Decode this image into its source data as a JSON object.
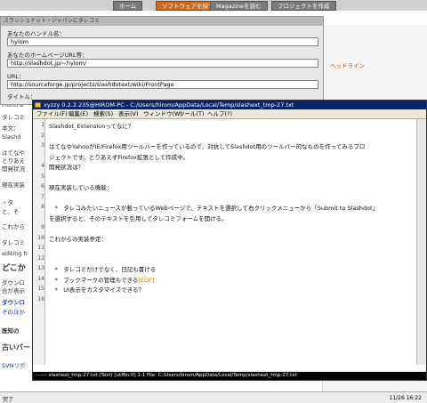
{
  "browser": {
    "tabs": [
      "ホーム",
      "ソフトウェアを探す",
      "Magazineを読む",
      "プロジェクトを作成"
    ],
    "statusbar_left": "完了",
    "statusbar_right": "11/26 16:22"
  },
  "slashdot_panel": {
    "title": "スラッシュドット・ジャパンにタレコミ",
    "handle_label": "あなたのハンドル名：",
    "handle_value": "hylom",
    "homepage_label": "あなたのホームページURL等：",
    "homepage_value": "http://slashdot.jp/~hylom/",
    "url_label": "URL：",
    "url_value": "http://sourceforge.jp/projects/slashdotext/wiki/FrontPage",
    "title_label": "タイトル："
  },
  "background_fragments": [
    "FrontPa",
    "タレコミ",
    "本文：",
    "Slashd",
    "はてなや",
    "とりあえ",
    "開発状況",
    "現在実装",
    "・タ",
    "と、そ",
    "これから",
    "タレコミ",
    "editing fr",
    "どこか",
    "ダウンロ",
    "合が表示",
    "ダウンロ",
    "そのほか",
    "既知の",
    "古いバー",
    "SVNリポ"
  ],
  "right_pane": {
    "heading_fragment": "ヘッドライン"
  },
  "editor": {
    "title": "xyzzy 0.2.2.235@HIROM-PC - C:/Users/hirom/AppData/Local/Temp/slashext_tmp-27.txt",
    "menu": [
      "ファイル(F)",
      "編集(E)",
      "検索(S)",
      "表示(V)",
      "ウィンドウ(W)",
      "ツール(T)",
      "ヘルプ(?)"
    ],
    "lines": [
      {
        "n": "1",
        "text": "Slashdot_Extensionってなに？"
      },
      {
        "n": "2",
        "text": ""
      },
      {
        "n": "3",
        "text": "はてなやYahooがIE/Firefox用ツールバーを作っているので、対抗してSlashdot用のツールバー的なものを作ってみるプロ"
      },
      {
        "n": "",
        "text": "ジェクトです。とりあえずFirefox拡張として作成中。"
      },
      {
        "n": "4",
        "text": "開発状況は？"
      },
      {
        "n": "5",
        "text": ""
      },
      {
        "n": "6",
        "text": "現在実装している機能："
      },
      {
        "n": "7",
        "text": ""
      },
      {
        "n": "8",
        "text": "　*　タレコみたいニュースが載っているWebページで、テキストを選択して右クリックメニューから「Submit to Slashdot」"
      },
      {
        "n": "",
        "text": "を選択すると、そのテキストを引用してタレコミフォームを開ける。"
      },
      {
        "n": "9",
        "text": ""
      },
      {
        "n": "10",
        "text": "これからの実装予定："
      },
      {
        "n": "11",
        "text": ""
      },
      {
        "n": "12",
        "text": ""
      },
      {
        "n": "13",
        "text": "　*　タレコミだけでなく、日記も書ける"
      },
      {
        "n": "14",
        "text": "　*　ブックマークの管理もできる"
      },
      {
        "n": "15",
        "text": "　*　UI表示をカスタマイズできる？"
      },
      {
        "n": "16",
        "text": ""
      }
    ],
    "eof_marker": "[EOF]",
    "status": "------ slashext_tmp-27.txt (Text) [utf8n:lf]         1:1         File: C:/Users/hirom/AppData/Local/Temp/slashext_tmp-27.txt"
  }
}
